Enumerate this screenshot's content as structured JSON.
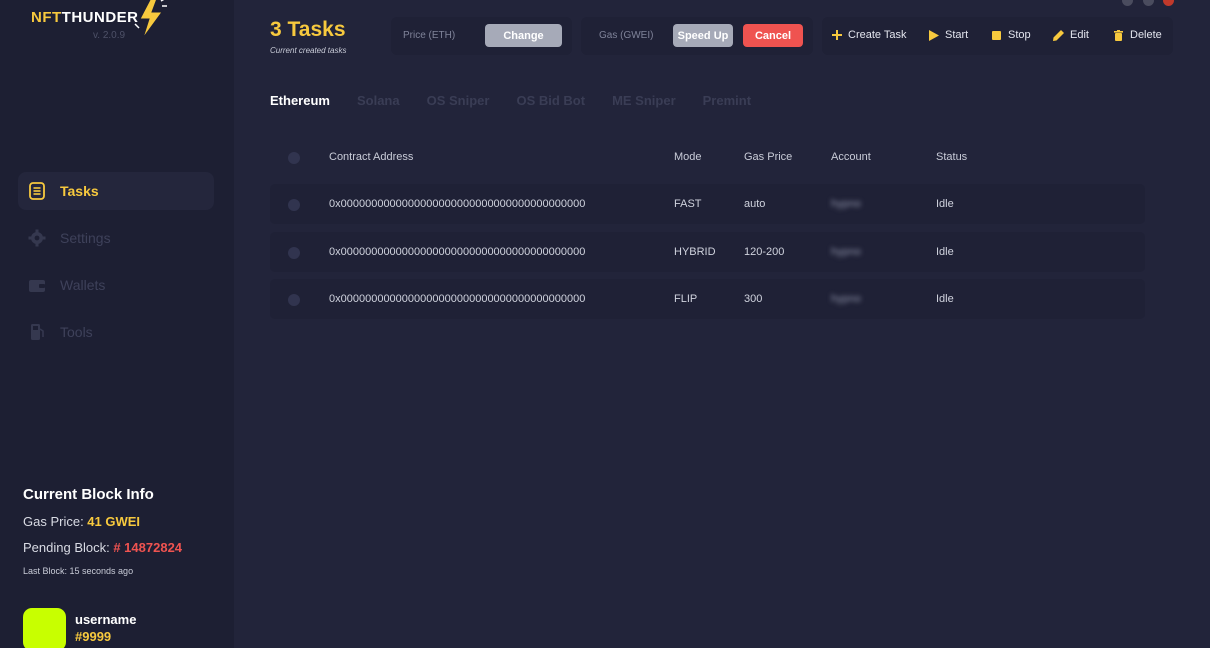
{
  "app": {
    "logo_nft": "NFT",
    "logo_thunder": "THUNDER",
    "version": "v. 2.0.9"
  },
  "sidebar": {
    "items": [
      {
        "label": "Tasks",
        "icon": "tasks-icon",
        "active": true
      },
      {
        "label": "Settings",
        "icon": "gear-icon",
        "active": false
      },
      {
        "label": "Wallets",
        "icon": "wallet-icon",
        "active": false
      },
      {
        "label": "Tools",
        "icon": "gas-pump-icon",
        "active": false
      }
    ]
  },
  "block_info": {
    "title": "Current Block Info",
    "gas_label": "Gas Price: ",
    "gas_value": "41 GWEI",
    "pending_label": "Pending Block: ",
    "pending_value": "# 14872824",
    "last_block": "Last Block: 15 seconds ago"
  },
  "user": {
    "name": "username",
    "tag": "#9999",
    "avatar_color": "#c8ff00"
  },
  "header": {
    "title": "3 Tasks",
    "subtitle": "Current created tasks",
    "price_label": "Price (ETH)",
    "change_label": "Change",
    "gas_label": "Gas (GWEI)",
    "speedup_label": "Speed Up",
    "cancel_label": "Cancel"
  },
  "toolbar": {
    "create": "Create Task",
    "start": "Start",
    "stop": "Stop",
    "edit": "Edit",
    "delete": "Delete"
  },
  "tabs": [
    "Ethereum",
    "Solana",
    "OS Sniper",
    "OS Bid Bot",
    "ME Sniper",
    "Premint"
  ],
  "table": {
    "headers": [
      "Contract Address",
      "Mode",
      "Gas Price",
      "Account",
      "Status"
    ],
    "rows": [
      {
        "address": "0x0000000000000000000000000000000000000000",
        "mode": "FAST",
        "gas": "auto",
        "account": "hypno",
        "status": "Idle"
      },
      {
        "address": "0x0000000000000000000000000000000000000000",
        "mode": "HYBRID",
        "gas": "120-200",
        "account": "hypno",
        "status": "Idle"
      },
      {
        "address": "0x0000000000000000000000000000000000000000",
        "mode": "FLIP",
        "gas": "300",
        "account": "hypno",
        "status": "Idle"
      }
    ]
  },
  "colors": {
    "accent": "#f7c93e",
    "danger": "#ef5350",
    "background": "#22243a",
    "sidebar": "#1d1f33"
  }
}
